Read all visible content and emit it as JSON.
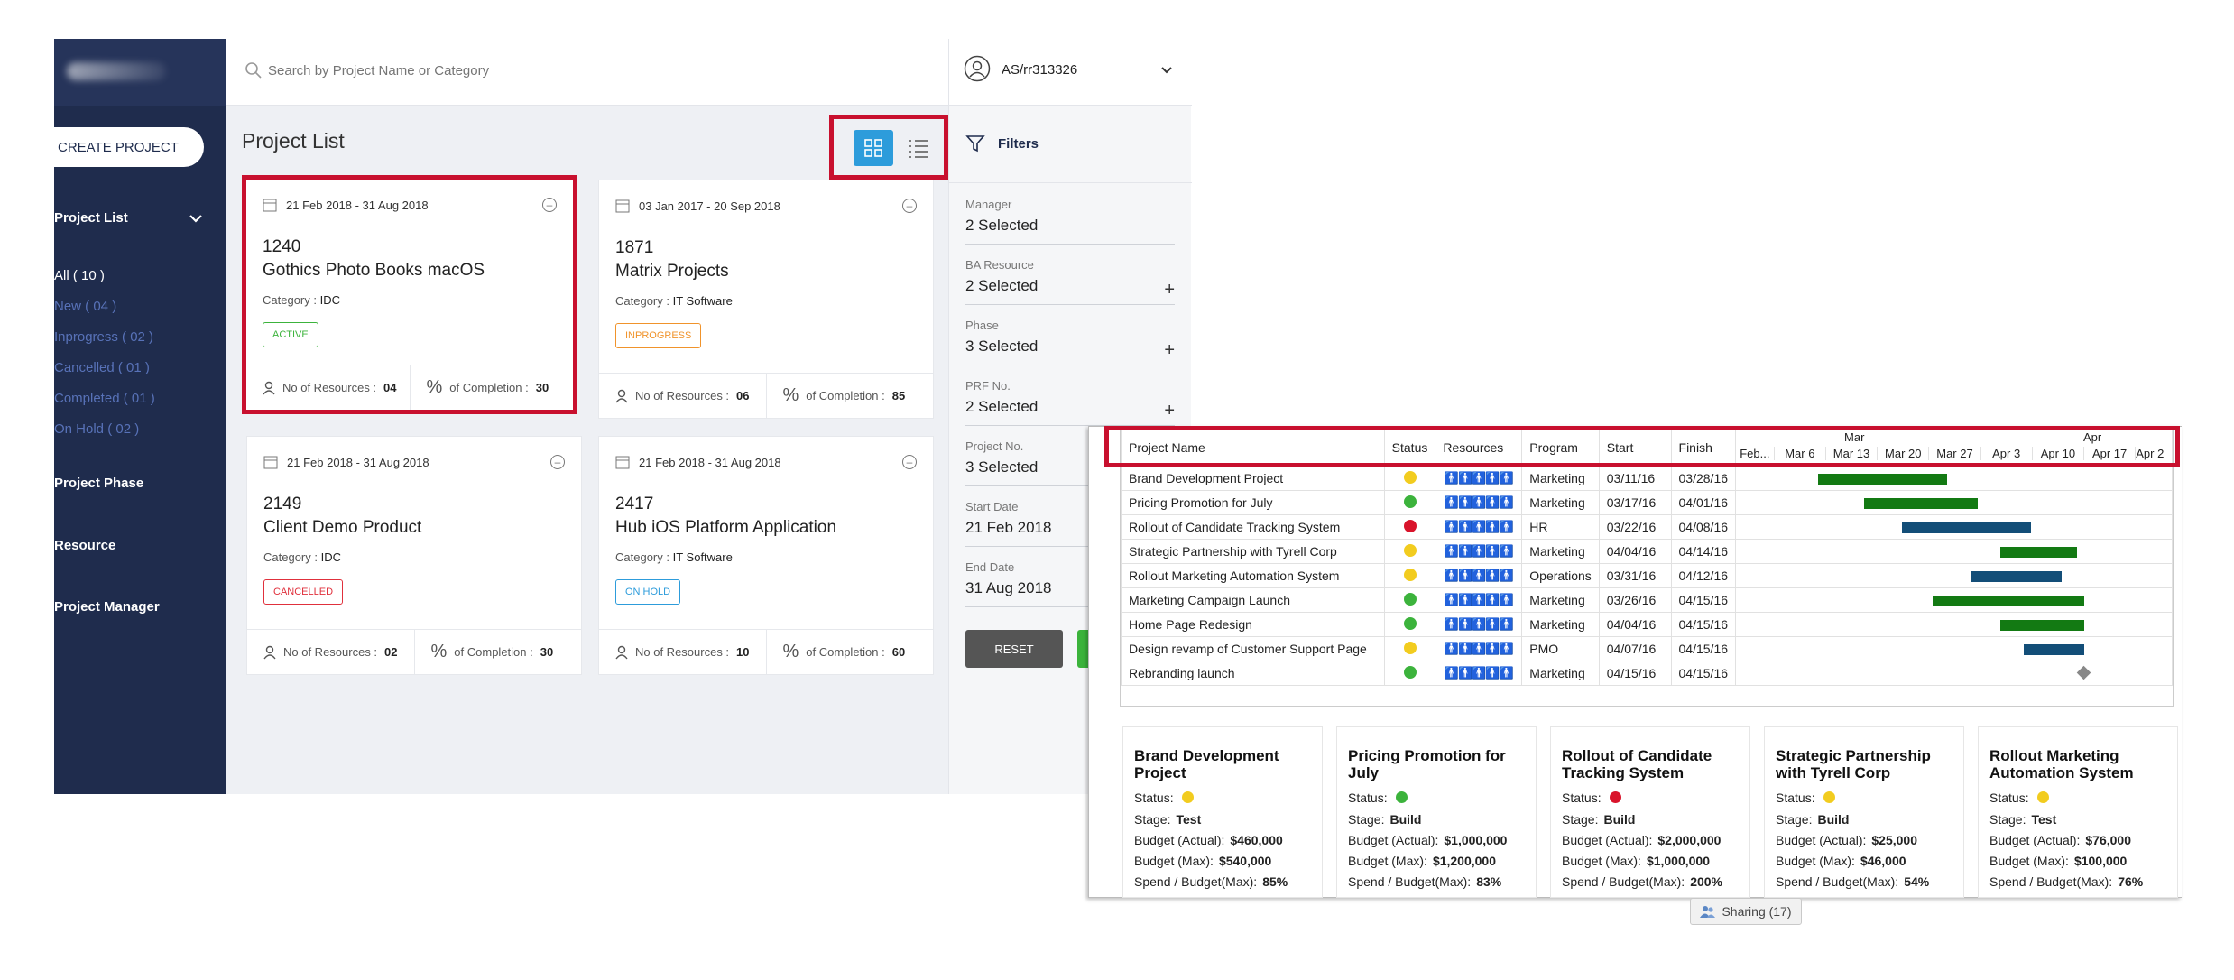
{
  "sidebar": {
    "create_button": "CREATE PROJECT",
    "project_list_label": "Project List",
    "items": [
      {
        "label": "All ( 10 )"
      },
      {
        "label": "New ( 04 )"
      },
      {
        "label": "Inprogress ( 02 )"
      },
      {
        "label": "Cancelled ( 01 )"
      },
      {
        "label": "Completed ( 01 )"
      },
      {
        "label": "On Hold ( 02 )"
      }
    ],
    "sections": [
      "Project Phase",
      "Resource",
      "Project Manager"
    ]
  },
  "search": {
    "placeholder": "Search by Project Name or Category"
  },
  "main": {
    "title": "Project List"
  },
  "cards": [
    {
      "date": "21 Feb 2018 - 31 Aug 2018",
      "id": "1240",
      "name": "Gothics Photo Books macOS",
      "category_label": "Category :",
      "category": "IDC",
      "status": "ACTIVE",
      "resources_label": "No of Resources :",
      "resources": "04",
      "completion_label": "of Completion :",
      "completion": "30"
    },
    {
      "date": "03 Jan 2017 - 20 Sep 2018",
      "id": "1871",
      "name": "Matrix Projects",
      "category_label": "Category :",
      "category": "IT Software",
      "status": "INPROGRESS",
      "resources_label": "No of Resources :",
      "resources": "06",
      "completion_label": "of Completion :",
      "completion": "85"
    },
    {
      "date": "21 Feb 2018 - 31 Aug 2018",
      "id": "2149",
      "name": "Client Demo Product",
      "category_label": "Category :",
      "category": "IDC",
      "status": "CANCELLED",
      "resources_label": "No of Resources :",
      "resources": "02",
      "completion_label": "of Completion :",
      "completion": "30"
    },
    {
      "date": "21 Feb 2018 - 31 Aug 2018",
      "id": "2417",
      "name": "Hub iOS Platform Application",
      "category_label": "Category :",
      "category": "IT Software",
      "status": "ON HOLD",
      "resources_label": "No of Resources :",
      "resources": "10",
      "completion_label": "of Completion :",
      "completion": "60"
    }
  ],
  "user": {
    "name": "AS/rr313326"
  },
  "filters": {
    "title": "Filters",
    "fields": [
      {
        "label": "Manager",
        "value": "2 Selected"
      },
      {
        "label": "BA Resource",
        "value": "2 Selected"
      },
      {
        "label": "Phase",
        "value": "3 Selected"
      },
      {
        "label": "PRF No.",
        "value": "2 Selected"
      },
      {
        "label": "Project No.",
        "value": "3 Selected"
      },
      {
        "label": "Start Date",
        "value": "21 Feb 2018"
      },
      {
        "label": "End Date",
        "value": "31 Aug 2018"
      }
    ],
    "reset": "RESET"
  },
  "gantt": {
    "headers": [
      "Project Name",
      "Status",
      "Resources",
      "Program",
      "Start",
      "Finish"
    ],
    "months": [
      "Mar",
      "Apr"
    ],
    "weeks": [
      "Feb...",
      "Mar 6",
      "Mar 13",
      "Mar 20",
      "Mar 27",
      "Apr 3",
      "Apr 10",
      "Apr 17",
      "Apr 2"
    ],
    "rows": [
      {
        "name": "Brand Development Project",
        "status": "#f2cc1f",
        "res": 1,
        "program": "Marketing",
        "start": "03/11/16",
        "finish": "03/28/16"
      },
      {
        "name": "Pricing Promotion for July",
        "status": "#3cb33c",
        "res": 3,
        "program": "Marketing",
        "start": "03/17/16",
        "finish": "04/01/16"
      },
      {
        "name": "Rollout of Candidate Tracking System",
        "status": "#d9142b",
        "res": 0,
        "program": "HR",
        "start": "03/22/16",
        "finish": "04/08/16"
      },
      {
        "name": "Strategic Partnership with Tyrell Corp",
        "status": "#f2cc1f",
        "res": 5,
        "program": "Marketing",
        "start": "04/04/16",
        "finish": "04/14/16"
      },
      {
        "name": "Rollout Marketing Automation System",
        "status": "#f2cc1f",
        "res": 1,
        "program": "Operations",
        "start": "03/31/16",
        "finish": "04/12/16"
      },
      {
        "name": "Marketing Campaign Launch",
        "status": "#3cb33c",
        "res": 3,
        "program": "Marketing",
        "start": "03/26/16",
        "finish": "04/15/16"
      },
      {
        "name": "Home Page Redesign",
        "status": "#3cb33c",
        "res": 5,
        "program": "Marketing",
        "start": "04/04/16",
        "finish": "04/15/16"
      },
      {
        "name": "Design revamp of Customer Support Page",
        "status": "#f2cc1f",
        "res": 3,
        "program": "PMO",
        "start": "04/07/16",
        "finish": "04/15/16"
      },
      {
        "name": "Rebranding launch",
        "status": "#3cb33c",
        "res": 5,
        "program": "Marketing",
        "start": "04/15/16",
        "finish": "04/15/16"
      }
    ]
  },
  "summaries": [
    {
      "title": "Brand Development Project",
      "status": "#f2cc1f",
      "stage": "Test",
      "budget_actual": "$460,000",
      "budget_max": "$540,000",
      "spend": "85%"
    },
    {
      "title": "Pricing Promotion for July",
      "status": "#3cb33c",
      "stage": "Build",
      "budget_actual": "$1,000,000",
      "budget_max": "$1,200,000",
      "spend": "83%"
    },
    {
      "title": "Rollout of Candidate Tracking System",
      "status": "#d9142b",
      "stage": "Build",
      "budget_actual": "$2,000,000",
      "budget_max": "$1,000,000",
      "spend": "200%"
    },
    {
      "title": "Strategic Partnership with Tyrell Corp",
      "status": "#f2cc1f",
      "stage": "Build",
      "budget_actual": "$25,000",
      "budget_max": "$46,000",
      "spend": "54%"
    },
    {
      "title": "Rollout Marketing Automation System",
      "status": "#f2cc1f",
      "stage": "Test",
      "budget_actual": "$76,000",
      "budget_max": "$100,000",
      "spend": "76%"
    }
  ],
  "summary_labels": {
    "status": "Status:",
    "stage": "Stage:",
    "budget_actual": "Budget (Actual):",
    "budget_max": "Budget (Max):",
    "spend": "Spend / Budget(Max):"
  },
  "sharing": "Sharing (17)"
}
